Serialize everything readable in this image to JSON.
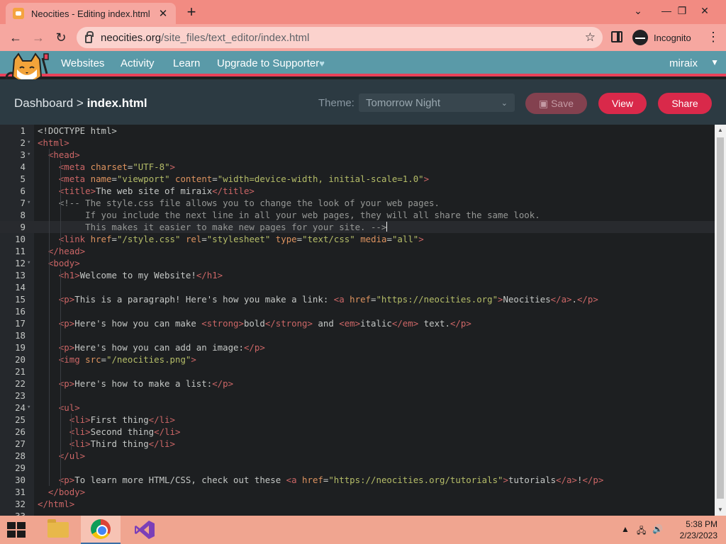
{
  "browser": {
    "tab_title": "Neocities - Editing index.html",
    "tab_close": "✕",
    "new_tab": "+",
    "url_host": "neocities.org",
    "url_path": "/site_files/text_editor/index.html",
    "incognito_label": "Incognito",
    "window_minimize": "—",
    "window_restore": "❐",
    "window_close": "✕",
    "tab_search": "⌄"
  },
  "site_nav": {
    "links": [
      "Websites",
      "Activity",
      "Learn",
      "Upgrade to Supporter"
    ],
    "supporter_heart": "♥",
    "user": "miraix",
    "user_caret": "▼"
  },
  "editor_header": {
    "crumb_root": "Dashboard",
    "crumb_sep": ">",
    "crumb_file": "index.html",
    "theme_label": "Theme:",
    "theme_value": "Tomorrow Night",
    "save_label": "Save",
    "view_label": "View",
    "share_label": "Share"
  },
  "code_lines": [
    {
      "n": "1",
      "fold": "",
      "html": "<span class='p'>&lt;!DOCTYPE html&gt;</span>"
    },
    {
      "n": "2",
      "fold": "▾",
      "html": "<span class='t'>&lt;html&gt;</span>"
    },
    {
      "n": "3",
      "fold": "▾",
      "html": "  <span class='t'>&lt;head&gt;</span>"
    },
    {
      "n": "4",
      "fold": "",
      "html": "    <span class='t'>&lt;meta</span> <span class='a'>charset</span>=<span class='s'>\"UTF-8\"</span><span class='t'>&gt;</span>"
    },
    {
      "n": "5",
      "fold": "",
      "html": "    <span class='t'>&lt;meta</span> <span class='a'>name</span>=<span class='s'>\"viewport\"</span> <span class='a'>content</span>=<span class='s'>\"width=device-width, initial-scale=1.0\"</span><span class='t'>&gt;</span>"
    },
    {
      "n": "6",
      "fold": "",
      "html": "    <span class='t'>&lt;title&gt;</span>The web site of miraix<span class='t'>&lt;/title&gt;</span>"
    },
    {
      "n": "7",
      "fold": "▾",
      "html": "    <span class='c'>&lt;!-- The style.css file allows you to change the look of your web pages.</span>"
    },
    {
      "n": "8",
      "fold": "",
      "html": "<span class='c'>         If you include the next line in all your web pages, they will all share the same look.</span>"
    },
    {
      "n": "9",
      "fold": "",
      "html": "<span class='c'>         This makes it easier to make new pages for your site. --&gt;</span><span class='cursor'></span>"
    },
    {
      "n": "10",
      "fold": "",
      "html": "    <span class='t'>&lt;link</span> <span class='a'>href</span>=<span class='s'>\"/style.css\"</span> <span class='a'>rel</span>=<span class='s'>\"stylesheet\"</span> <span class='a'>type</span>=<span class='s'>\"text/css\"</span> <span class='a'>media</span>=<span class='s'>\"all\"</span><span class='t'>&gt;</span>"
    },
    {
      "n": "11",
      "fold": "",
      "html": "  <span class='t'>&lt;/head&gt;</span>"
    },
    {
      "n": "12",
      "fold": "▾",
      "html": "  <span class='t'>&lt;body&gt;</span>"
    },
    {
      "n": "13",
      "fold": "",
      "html": "    <span class='t'>&lt;h1&gt;</span>Welcome to my Website!<span class='t'>&lt;/h1&gt;</span>"
    },
    {
      "n": "14",
      "fold": "",
      "html": ""
    },
    {
      "n": "15",
      "fold": "",
      "html": "    <span class='t'>&lt;p&gt;</span>This is a paragraph! Here's how you make a link: <span class='t'>&lt;a</span> <span class='a'>href</span>=<span class='s'>\"https://neocities.org\"</span><span class='t'>&gt;</span>Neocities<span class='t'>&lt;/a&gt;</span>.<span class='t'>&lt;/p&gt;</span>"
    },
    {
      "n": "16",
      "fold": "",
      "html": ""
    },
    {
      "n": "17",
      "fold": "",
      "html": "    <span class='t'>&lt;p&gt;</span>Here's how you can make <span class='t'>&lt;strong&gt;</span>bold<span class='t'>&lt;/strong&gt;</span> and <span class='t'>&lt;em&gt;</span>italic<span class='t'>&lt;/em&gt;</span> text.<span class='t'>&lt;/p&gt;</span>"
    },
    {
      "n": "18",
      "fold": "",
      "html": ""
    },
    {
      "n": "19",
      "fold": "",
      "html": "    <span class='t'>&lt;p&gt;</span>Here's how you can add an image:<span class='t'>&lt;/p&gt;</span>"
    },
    {
      "n": "20",
      "fold": "",
      "html": "    <span class='t'>&lt;img</span> <span class='a'>src</span>=<span class='s'>\"/neocities.png\"</span><span class='t'>&gt;</span>"
    },
    {
      "n": "21",
      "fold": "",
      "html": ""
    },
    {
      "n": "22",
      "fold": "",
      "html": "    <span class='t'>&lt;p&gt;</span>Here's how to make a list:<span class='t'>&lt;/p&gt;</span>"
    },
    {
      "n": "23",
      "fold": "",
      "html": ""
    },
    {
      "n": "24",
      "fold": "▾",
      "html": "    <span class='t'>&lt;ul&gt;</span>"
    },
    {
      "n": "25",
      "fold": "",
      "html": "      <span class='t'>&lt;li&gt;</span>First thing<span class='t'>&lt;/li&gt;</span>"
    },
    {
      "n": "26",
      "fold": "",
      "html": "      <span class='t'>&lt;li&gt;</span>Second thing<span class='t'>&lt;/li&gt;</span>"
    },
    {
      "n": "27",
      "fold": "",
      "html": "      <span class='t'>&lt;li&gt;</span>Third thing<span class='t'>&lt;/li&gt;</span>"
    },
    {
      "n": "28",
      "fold": "",
      "html": "    <span class='t'>&lt;/ul&gt;</span>"
    },
    {
      "n": "29",
      "fold": "",
      "html": ""
    },
    {
      "n": "30",
      "fold": "",
      "html": "    <span class='t'>&lt;p&gt;</span>To learn more HTML/CSS, check out these <span class='t'>&lt;a</span> <span class='a'>href</span>=<span class='s'>\"https://neocities.org/tutorials\"</span><span class='t'>&gt;</span>tutorials<span class='t'>&lt;/a&gt;</span>!<span class='t'>&lt;/p&gt;</span>"
    },
    {
      "n": "31",
      "fold": "",
      "html": "  <span class='t'>&lt;/body&gt;</span>"
    },
    {
      "n": "32",
      "fold": "",
      "html": "<span class='t'>&lt;/html&gt;</span>"
    },
    {
      "n": "33",
      "fold": "",
      "html": ""
    }
  ],
  "active_line": 9,
  "taskbar": {
    "clock_time": "5:38 PM",
    "clock_date": "2/23/2023",
    "tray_up": "▲"
  },
  "colors": {
    "tab_strip": "#f28b82",
    "site_nav": "#5a9aa8",
    "accent_red": "#d9294a",
    "editor_bg": "#1d1f21"
  }
}
